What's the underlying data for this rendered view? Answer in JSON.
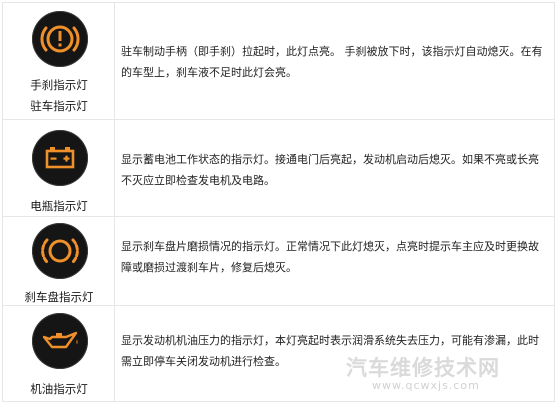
{
  "rows": [
    {
      "icon": "handbrake-warning-icon",
      "names": [
        "手刹指示灯",
        "驻车指示灯"
      ],
      "description": "驻车制动手柄（即手刹）拉起时，此灯点亮。 手刹被放下时，该指示灯自动熄灭。在有的车型上，刹车液不足时此灯会亮。"
    },
    {
      "icon": "battery-icon",
      "names": [
        "电瓶指示灯"
      ],
      "description": "显示蓄电池工作状态的指示灯。接通电门后亮起，发动机启动后熄灭。如果不亮或长亮不灭应立即检查发电机及电路。"
    },
    {
      "icon": "brake-pad-wear-icon",
      "names": [
        "刹车盘指示灯"
      ],
      "description": "显示刹车盘片磨损情况的指示灯。正常情况下此灯熄灭，点亮时提示车主应及时更换故障或磨损过渡刹车片，修复后熄灭。"
    },
    {
      "icon": "oil-can-icon",
      "names": [
        "机油指示灯"
      ],
      "description": "显示发动机机油压力的指示灯，本灯亮起时表示润滑系统失去压力，可能有渗漏，此时需立即停车关闭发动机进行检查。"
    }
  ],
  "watermark": {
    "line1": "汽车维修技术网",
    "line2": "www.qcwxjs.com"
  },
  "colors": {
    "icon_orange": "#f0902a",
    "icon_bg": "#151515",
    "border": "#e6e6e6"
  }
}
